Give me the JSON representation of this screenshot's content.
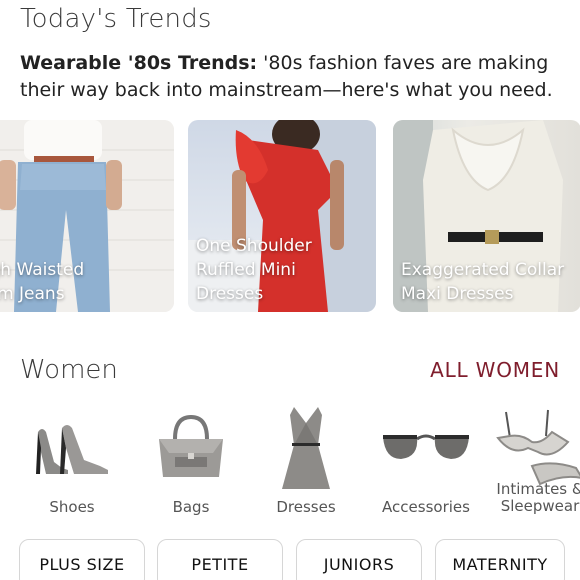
{
  "trends": {
    "title": "Today's Trends",
    "headline": "Wearable '80s Trends:",
    "description": " '80s fashion faves are making their way back into mainstream—here's what you need.",
    "cards": [
      {
        "label": "High Waisted\nMom Jeans"
      },
      {
        "label": "One Shoulder\nRuffled Mini\nDresses"
      },
      {
        "label": "Exaggerated Collar\nMaxi Dresses"
      }
    ]
  },
  "women": {
    "title": "Women",
    "all_link": "ALL WOMEN",
    "categories": [
      {
        "label": "Shoes",
        "icon": "heels-icon"
      },
      {
        "label": "Bags",
        "icon": "handbag-icon"
      },
      {
        "label": "Dresses",
        "icon": "dress-icon"
      },
      {
        "label": "Accessories",
        "icon": "sunglasses-icon"
      },
      {
        "label": "Intimates &\nSleepwear",
        "icon": "bra-icon"
      }
    ],
    "size_chips": [
      "PLUS SIZE",
      "PETITE",
      "JUNIORS",
      "MATERNITY"
    ]
  },
  "colors": {
    "accent": "#7f1d2c"
  }
}
